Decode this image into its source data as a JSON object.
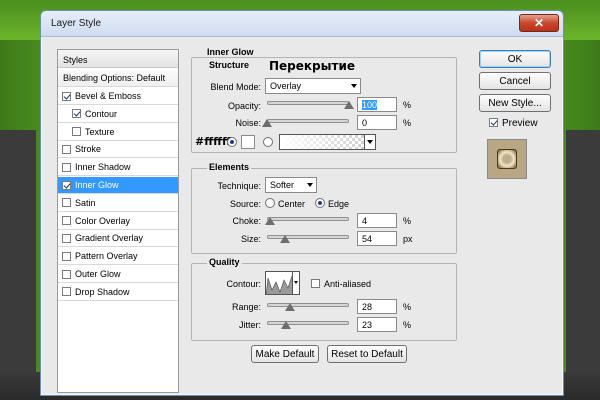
{
  "window": {
    "title": "Layer Style",
    "close_glyph": "✕"
  },
  "styles_panel": {
    "header": "Styles",
    "blending_options": "Blending Options: Default",
    "items": [
      {
        "label": "Bevel & Emboss",
        "checked": true
      },
      {
        "label": "Contour",
        "checked": true,
        "sub": true
      },
      {
        "label": "Texture",
        "checked": false,
        "sub": true
      },
      {
        "label": "Stroke",
        "checked": false
      },
      {
        "label": "Inner Shadow",
        "checked": false
      },
      {
        "label": "Inner Glow",
        "checked": true,
        "selected": true
      },
      {
        "label": "Satin",
        "checked": false
      },
      {
        "label": "Color Overlay",
        "checked": false
      },
      {
        "label": "Gradient Overlay",
        "checked": false
      },
      {
        "label": "Pattern Overlay",
        "checked": false
      },
      {
        "label": "Outer Glow",
        "checked": false
      },
      {
        "label": "Drop Shadow",
        "checked": false
      }
    ]
  },
  "inner_glow": {
    "title": "Inner Glow",
    "structure": {
      "title": "Structure",
      "blend_mode_label": "Blend Mode:",
      "blend_mode_value": "Overlay",
      "opacity_label": "Opacity:",
      "opacity_value": "100",
      "opacity_unit": "%",
      "opacity_fraction": 1.0,
      "noise_label": "Noise:",
      "noise_value": "0",
      "noise_unit": "%",
      "noise_fraction": 0.0,
      "color_annotation": "#ffffff",
      "blend_annotation": "Перекрытие"
    },
    "elements": {
      "title": "Elements",
      "technique_label": "Technique:",
      "technique_value": "Softer",
      "source_label": "Source:",
      "source_center": "Center",
      "source_edge": "Edge",
      "choke_label": "Choke:",
      "choke_value": "4",
      "choke_unit": "%",
      "choke_fraction": 0.04,
      "size_label": "Size:",
      "size_value": "54",
      "size_unit": "px",
      "size_fraction": 0.22
    },
    "quality": {
      "title": "Quality",
      "contour_label": "Contour:",
      "anti_aliased_label": "Anti-aliased",
      "range_label": "Range:",
      "range_value": "28",
      "range_unit": "%",
      "range_fraction": 0.28,
      "jitter_label": "Jitter:",
      "jitter_value": "23",
      "jitter_unit": "%",
      "jitter_fraction": 0.23
    },
    "make_default": "Make Default",
    "reset_default": "Reset to Default"
  },
  "actions": {
    "ok": "OK",
    "cancel": "Cancel",
    "new_style": "New Style...",
    "preview_label": "Preview"
  },
  "colors": {
    "accent": "#3399ff",
    "window_bg": "#e9e9e9",
    "close_red": "#c9462b"
  }
}
